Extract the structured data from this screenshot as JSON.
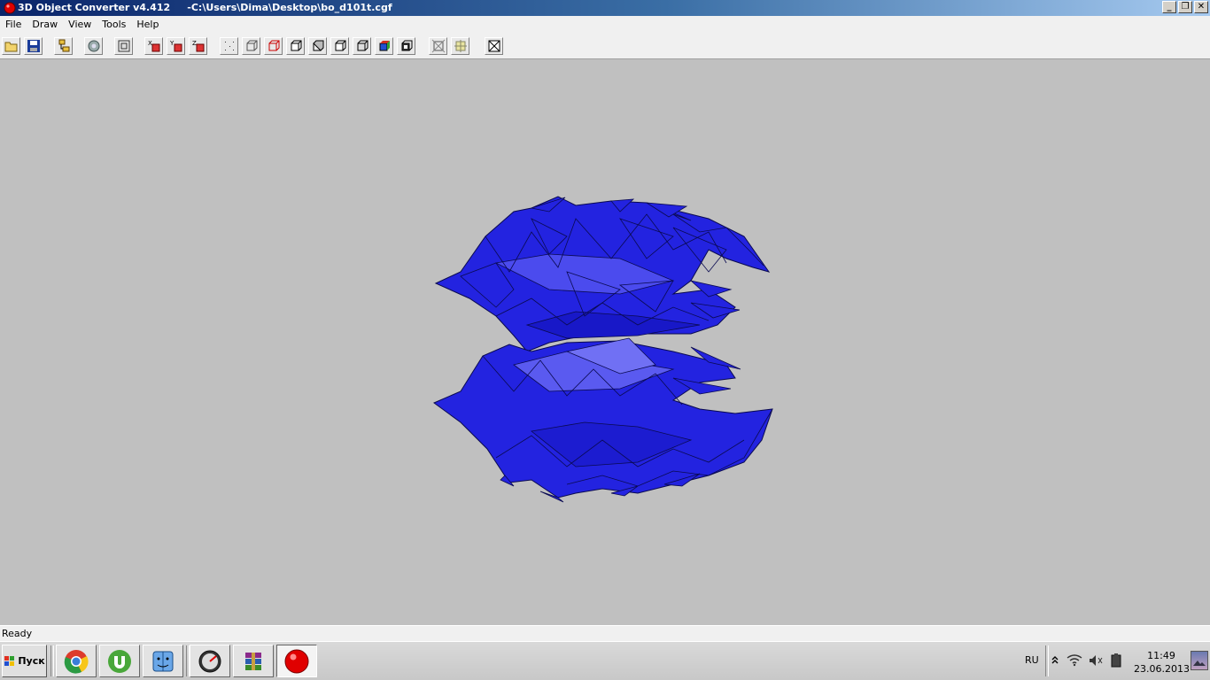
{
  "window": {
    "title": "3D Object Converter v4.412     -C:\\Users\\Dima\\Desktop\\bo_d101t.cgf",
    "buttons": {
      "minimize": "_",
      "maximize": "❐",
      "close": "✕"
    }
  },
  "menu": [
    "File",
    "Draw",
    "View",
    "Tools",
    "Help"
  ],
  "toolbar": {
    "buttons": [
      {
        "name": "open-icon"
      },
      {
        "name": "save-icon"
      },
      {
        "name": "scene-tree-icon"
      },
      {
        "name": "settings-icon"
      },
      {
        "name": "zoom-fit-icon"
      },
      {
        "name": "rotate-x-icon",
        "label": "X"
      },
      {
        "name": "rotate-y-icon",
        "label": "Y"
      },
      {
        "name": "rotate-z-icon",
        "label": "Z"
      },
      {
        "name": "points-mode-icon"
      },
      {
        "name": "wireframe-mode-icon"
      },
      {
        "name": "wireframe-red-icon"
      },
      {
        "name": "box-mode-icon"
      },
      {
        "name": "flat-mode-icon"
      },
      {
        "name": "gouraud-mode-icon"
      },
      {
        "name": "smooth-mode-icon"
      },
      {
        "name": "color-mode-icon"
      },
      {
        "name": "texture-mode-icon"
      },
      {
        "name": "normals-icon"
      },
      {
        "name": "bounding-icon"
      },
      {
        "name": "close-view-icon"
      }
    ]
  },
  "model": {
    "fill_color": "#2323e0",
    "edge_color": "#0a0a50",
    "highlight_color": "#5a5af0"
  },
  "status": {
    "text": "Ready"
  },
  "taskbar": {
    "start_label": "Пуск",
    "apps": [
      "chrome-icon",
      "utorrent-icon",
      "finder-icon",
      "speedometer-icon",
      "winrar-icon",
      "object-converter-icon"
    ],
    "language": "RU",
    "time": "11:49",
    "date": "23.06.2013"
  }
}
